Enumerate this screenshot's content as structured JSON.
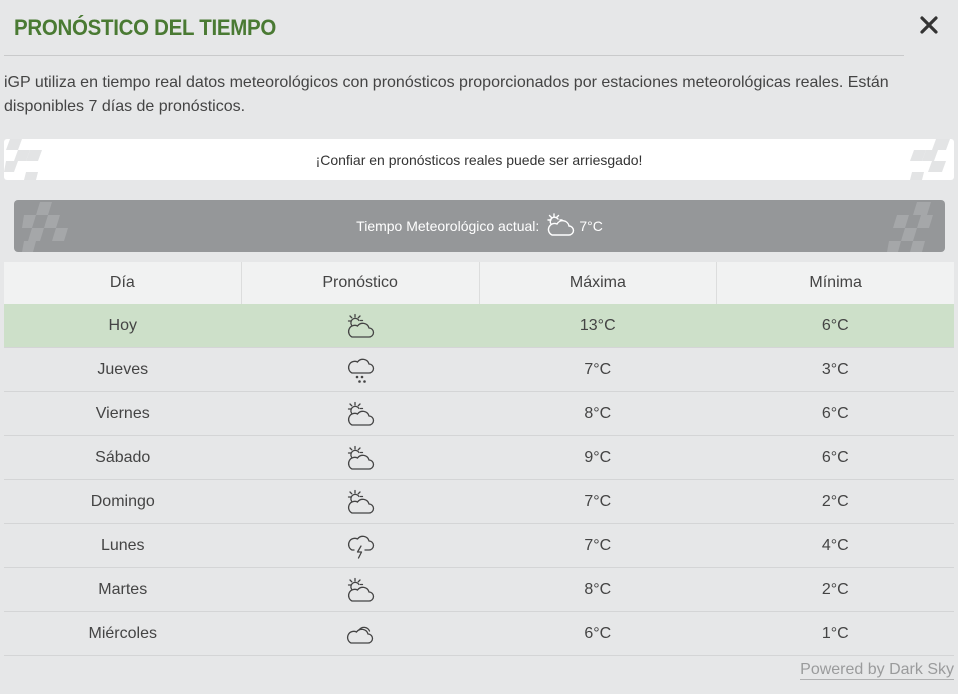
{
  "title": "PRONÓSTICO DEL TIEMPO",
  "close_icon": "close-icon",
  "intro": "iGP utiliza en tiempo real datos meteorológicos con pronósticos proporcionados por estaciones meteorológicas reales. Están disponibles 7 días de pronósticos.",
  "warning": "¡Confiar en pronósticos reales puede ser arriesgado!",
  "current": {
    "label": "Tiempo Meteorológico actual:",
    "icon": "partly-cloudy-icon",
    "temp": "7°C"
  },
  "table": {
    "headers": [
      "Día",
      "Pronóstico",
      "Máxima",
      "Mínima"
    ],
    "rows": [
      {
        "day": "Hoy",
        "icon": "partly-cloudy-icon",
        "max": "13°C",
        "min": "6°C"
      },
      {
        "day": "Jueves",
        "icon": "rain-icon",
        "max": "7°C",
        "min": "3°C"
      },
      {
        "day": "Viernes",
        "icon": "partly-cloudy-icon",
        "max": "8°C",
        "min": "6°C"
      },
      {
        "day": "Sábado",
        "icon": "partly-cloudy-icon",
        "max": "9°C",
        "min": "6°C"
      },
      {
        "day": "Domingo",
        "icon": "partly-cloudy-icon",
        "max": "7°C",
        "min": "2°C"
      },
      {
        "day": "Lunes",
        "icon": "thunderstorm-icon",
        "max": "7°C",
        "min": "4°C"
      },
      {
        "day": "Martes",
        "icon": "partly-cloudy-icon",
        "max": "8°C",
        "min": "2°C"
      },
      {
        "day": "Miércoles",
        "icon": "cloudy-icon",
        "max": "6°C",
        "min": "1°C"
      }
    ]
  },
  "footer": {
    "powered": "Powered by Dark Sky"
  },
  "colors": {
    "title": "#4a7a33",
    "today_row": "#cde0c9",
    "current_bar": "#959799",
    "background": "#e6e7e8"
  }
}
